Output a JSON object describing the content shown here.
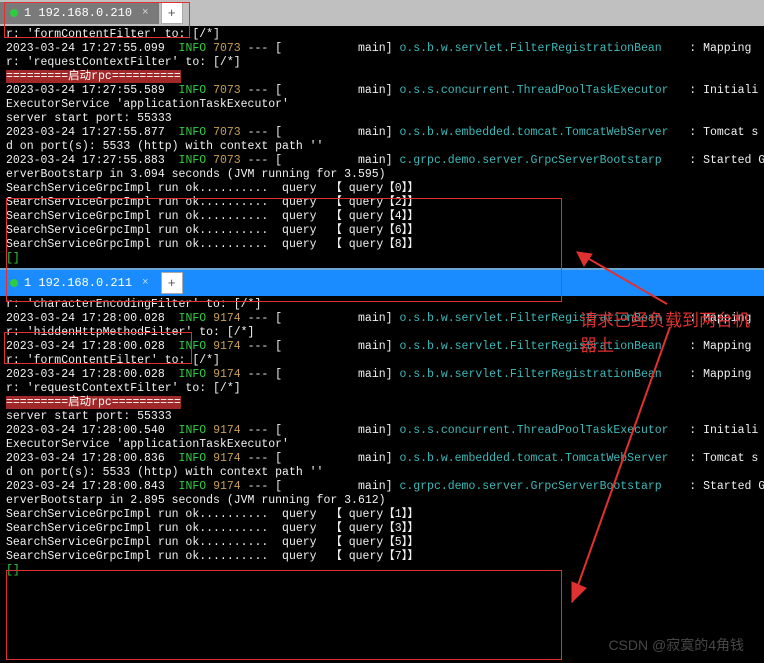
{
  "tabs": {
    "top": {
      "label": "1 192.168.0.210"
    },
    "bottom": {
      "label": "1 192.168.0.211"
    }
  },
  "annotation": "请求已经负载到两台机器上",
  "watermark": "CSDN @寂寞的4角钱",
  "top_lines": [
    {
      "pre": "r: 'formContentFilter' to: [/*]"
    },
    {
      "ts": "2023-03-24 17:27:55.099",
      "lvl": "INFO",
      "pid": "7073",
      "seg": "--- [",
      "ctx": "main]",
      "cls": "o.s.b.w.servlet.FilterRegistrationBean",
      "msg": ": Mapping "
    },
    {
      "pre": "r: 'requestContextFilter' to: [/*]"
    },
    {
      "pre_red": "=========启动rpc=========="
    },
    {
      "ts": "2023-03-24 17:27:55.589",
      "lvl": "INFO",
      "pid": "7073",
      "seg": "--- [",
      "ctx": "main]",
      "cls": "o.s.s.concurrent.ThreadPoolTaskExecutor",
      "msg": ": Initiali"
    },
    {
      "pre": "ExecutorService 'applicationTaskExecutor'"
    },
    {
      "pre": "server start port: 55333"
    },
    {
      "ts": "2023-03-24 17:27:55.877",
      "lvl": "INFO",
      "pid": "7073",
      "seg": "--- [",
      "ctx": "main]",
      "cls": "o.s.b.w.embedded.tomcat.TomcatWebServer",
      "msg": ": Tomcat s"
    },
    {
      "pre": "d on port(s): 5533 (http) with context path ''"
    },
    {
      "ts": "2023-03-24 17:27:55.883",
      "lvl": "INFO",
      "pid": "7073",
      "seg": "--- [",
      "ctx": "main]",
      "cls": "c.grpc.demo.server.GrpcServerBootstarp",
      "msg": ": Started G"
    },
    {
      "pre": "erverBootstarp in 3.094 seconds (JVM running for 3.595)"
    },
    {
      "pre": "SearchServiceGrpcImpl run ok..........  query  【 query【0】】"
    },
    {
      "pre": "SearchServiceGrpcImpl run ok..........  query  【 query【2】】"
    },
    {
      "pre": "SearchServiceGrpcImpl run ok..........  query  【 query【4】】"
    },
    {
      "pre": "SearchServiceGrpcImpl run ok..........  query  【 query【6】】"
    },
    {
      "pre": "SearchServiceGrpcImpl run ok..........  query  【 query【8】】"
    },
    {
      "pre_g": "[]"
    }
  ],
  "bottom_lines": [
    {
      "pre": "r: 'characterEncodingFilter' to: [/*]"
    },
    {
      "ts": "2023-03-24 17:28:00.028",
      "lvl": "INFO",
      "pid": "9174",
      "seg": "--- [",
      "ctx": "main]",
      "cls": "o.s.b.w.servlet.FilterRegistrationBean",
      "msg": ": Mapping "
    },
    {
      "pre": "r: 'hiddenHttpMethodFilter' to: [/*]"
    },
    {
      "ts": "2023-03-24 17:28:00.028",
      "lvl": "INFO",
      "pid": "9174",
      "seg": "--- [",
      "ctx": "main]",
      "cls": "o.s.b.w.servlet.FilterRegistrationBean",
      "msg": ": Mapping "
    },
    {
      "pre": "r: 'formContentFilter' to: [/*]"
    },
    {
      "ts": "2023-03-24 17:28:00.028",
      "lvl": "INFO",
      "pid": "9174",
      "seg": "--- [",
      "ctx": "main]",
      "cls": "o.s.b.w.servlet.FilterRegistrationBean",
      "msg": ": Mapping "
    },
    {
      "pre": "r: 'requestContextFilter' to: [/*]"
    },
    {
      "pre_red": "=========启动rpc=========="
    },
    {
      "pre": "server start port: 55333"
    },
    {
      "ts": "2023-03-24 17:28:00.540",
      "lvl": "INFO",
      "pid": "9174",
      "seg": "--- [",
      "ctx": "main]",
      "cls": "o.s.s.concurrent.ThreadPoolTaskExecutor",
      "msg": ": Initiali"
    },
    {
      "pre": "ExecutorService 'applicationTaskExecutor'"
    },
    {
      "ts": "2023-03-24 17:28:00.836",
      "lvl": "INFO",
      "pid": "9174",
      "seg": "--- [",
      "ctx": "main]",
      "cls": "o.s.b.w.embedded.tomcat.TomcatWebServer",
      "msg": ": Tomcat s"
    },
    {
      "pre": "d on port(s): 5533 (http) with context path ''"
    },
    {
      "ts": "2023-03-24 17:28:00.843",
      "lvl": "INFO",
      "pid": "9174",
      "seg": "--- [",
      "ctx": "main]",
      "cls": "c.grpc.demo.server.GrpcServerBootstarp",
      "msg": ": Started G"
    },
    {
      "pre": "erverBootstarp in 2.895 seconds (JVM running for 3.612)"
    },
    {
      "pre": "SearchServiceGrpcImpl run ok..........  query  【 query【1】】"
    },
    {
      "pre": "SearchServiceGrpcImpl run ok..........  query  【 query【3】】"
    },
    {
      "pre": "SearchServiceGrpcImpl run ok..........  query  【 query【5】】"
    },
    {
      "pre": "SearchServiceGrpcImpl run ok..........  query  【 query【7】】"
    },
    {
      "pre_g": "[]"
    }
  ]
}
